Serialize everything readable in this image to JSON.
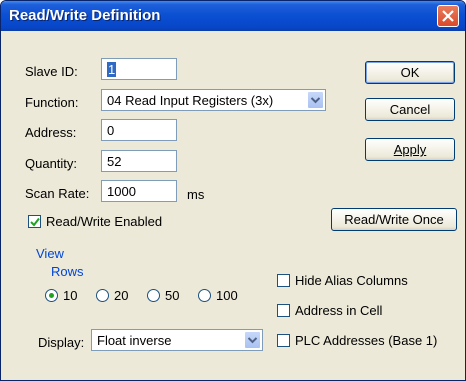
{
  "window": {
    "title": "Read/Write Definition"
  },
  "fields": {
    "slave_id": {
      "label": "Slave ID:",
      "value": "1"
    },
    "function": {
      "label": "Function:",
      "value": "04 Read Input Registers (3x)"
    },
    "address": {
      "label": "Address:",
      "value": "0"
    },
    "quantity": {
      "label": "Quantity:",
      "value": "52"
    },
    "scan_rate": {
      "label": "Scan Rate:",
      "value": "1000",
      "unit": "ms"
    }
  },
  "read_write_enabled": {
    "label": "Read/Write Enabled",
    "checked": true
  },
  "buttons": {
    "ok": "OK",
    "cancel": "Cancel",
    "apply": "Apply",
    "read_write_once": "Read/Write Once"
  },
  "view": {
    "title": "View",
    "rows_label": "Rows",
    "rows_options": [
      "10",
      "20",
      "50",
      "100"
    ],
    "rows_selected": "10",
    "display_label": "Display:",
    "display_value": "Float inverse",
    "hide_alias_columns": {
      "label": "Hide Alias Columns",
      "checked": false
    },
    "address_in_cell": {
      "label": "Address in Cell",
      "checked": false
    },
    "plc_addresses": {
      "label": "PLC Addresses (Base 1)",
      "checked": false
    }
  }
}
